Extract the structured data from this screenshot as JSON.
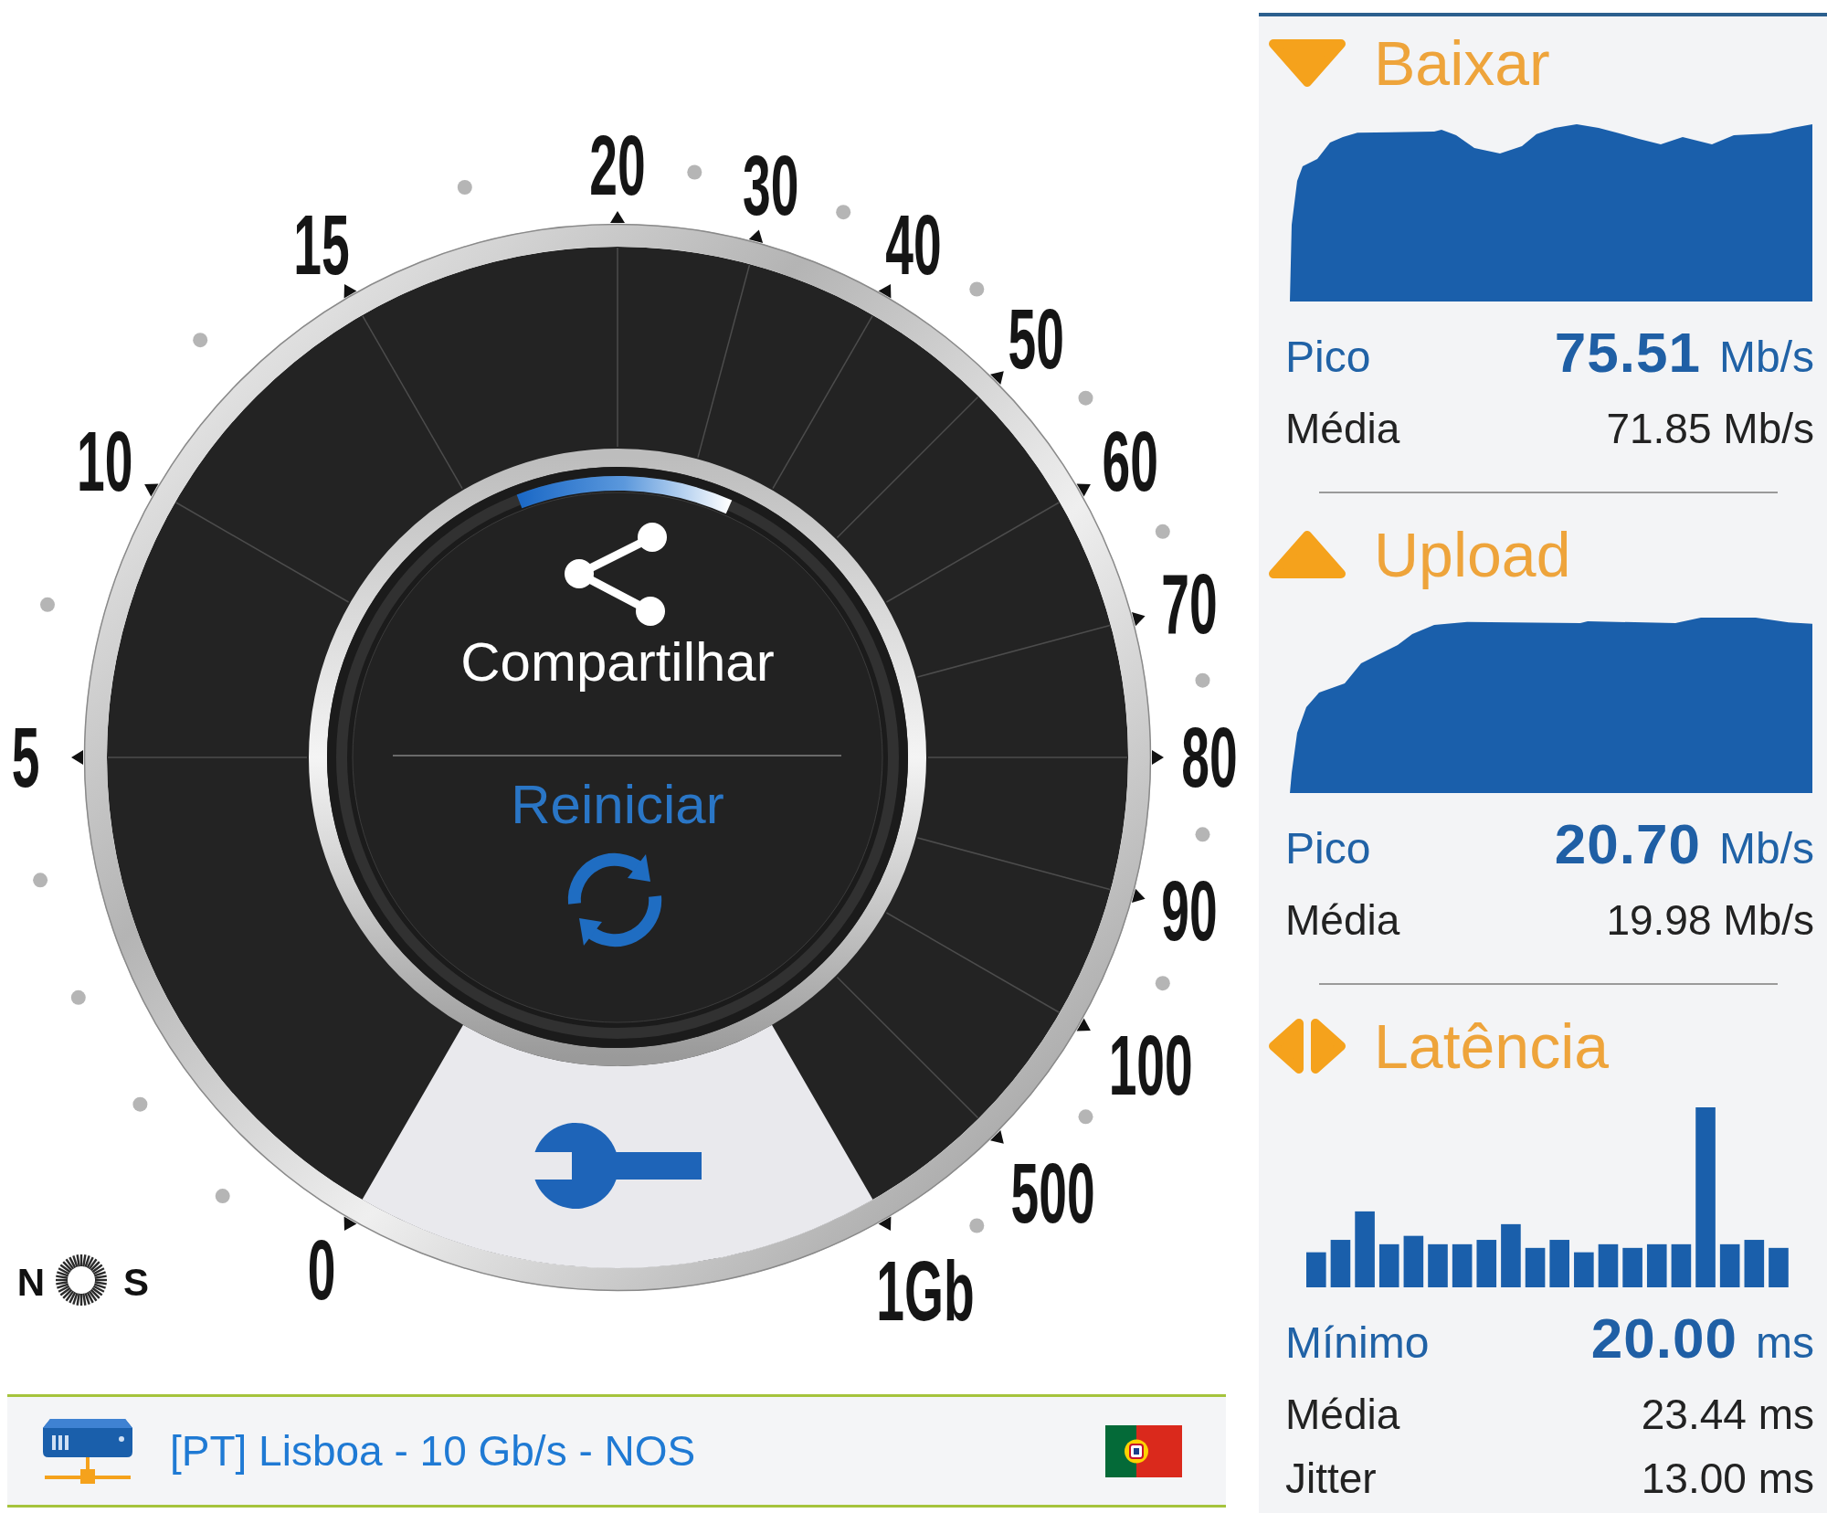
{
  "gauge": {
    "scale_labels": [
      "0",
      "5",
      "10",
      "15",
      "20",
      "30",
      "40",
      "50",
      "60",
      "70",
      "80",
      "90",
      "100",
      "500",
      "1Gb"
    ],
    "share_button": {
      "label": "Compartilhar"
    },
    "restart_button": {
      "label": "Reiniciar"
    }
  },
  "brand_logo": {
    "letter_before_ring": "N",
    "letter_after_ring": "S"
  },
  "server": {
    "name": "[PT] Lisboa - 10 Gb/s - NOS"
  },
  "results": [
    {
      "kind": "download",
      "title": "Baixar",
      "peak": {
        "label": "Pico",
        "value": "75.51",
        "unit": "Mb/s"
      },
      "stats": [
        {
          "label": "Média",
          "value": "71.85 Mb/s"
        }
      ]
    },
    {
      "kind": "upload",
      "title": "Upload",
      "peak": {
        "label": "Pico",
        "value": "20.70",
        "unit": "Mb/s"
      },
      "stats": [
        {
          "label": "Média",
          "value": "19.98 Mb/s"
        }
      ]
    },
    {
      "kind": "latency",
      "title": "Latência",
      "peak": {
        "label": "Mínimo",
        "value": "20.00",
        "unit": "ms"
      },
      "stats": [
        {
          "label": "Média",
          "value": "23.44 ms"
        },
        {
          "label": "Jitter",
          "value": "13.00 ms"
        }
      ]
    }
  ]
}
